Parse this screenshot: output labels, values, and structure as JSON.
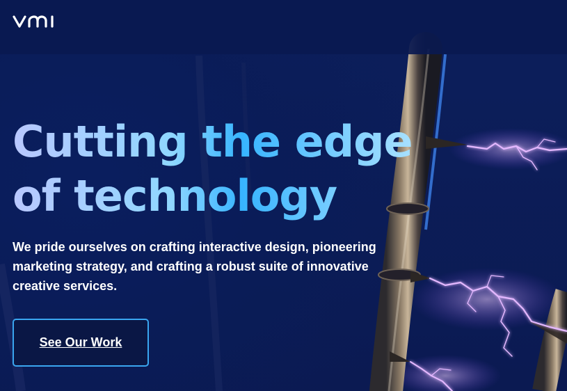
{
  "brand": {
    "logo_text": "vmi",
    "logo_icon": "vmi-logo-icon"
  },
  "hero": {
    "headline_line1": "Cutting the edge",
    "headline_line2": "of technology",
    "subtext": "We pride ourselves on crafting interactive design, pioneering marketing strategy, and crafting a robust suite of innovative creative services.",
    "cta_label": "See Our Work",
    "background_image": "tesla-coil-lightning"
  },
  "colors": {
    "background": "#0b1a52",
    "header_bg": "#0a1950",
    "headline_gradient_start": "#b9c8ff",
    "headline_gradient_mid": "#37b4ff",
    "button_border": "#3aa6f0",
    "lightning": "#d9a8ff"
  }
}
